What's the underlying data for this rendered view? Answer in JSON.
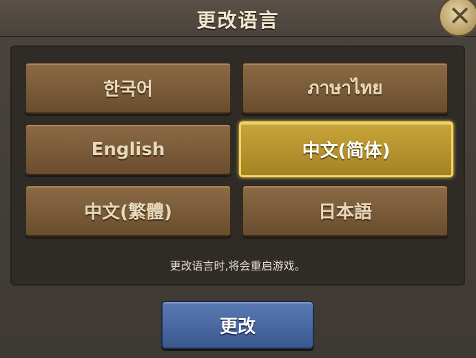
{
  "dialog": {
    "title": "更改语言",
    "close_icon": "close-x-icon"
  },
  "languages": [
    {
      "label": "한국어",
      "selected": false
    },
    {
      "label": "ภาษาไทย",
      "selected": false
    },
    {
      "label": "English",
      "selected": false
    },
    {
      "label": "中文(简体)",
      "selected": true
    },
    {
      "label": "中文(繁體)",
      "selected": false
    },
    {
      "label": "日本語",
      "selected": false
    }
  ],
  "notice": "更改语言时,将会重启游戏。",
  "confirm_label": "更改",
  "colors": {
    "selected_accent": "#f3d65b",
    "button_brown": "#7a5c3a",
    "confirm_blue": "#4a68a0"
  }
}
